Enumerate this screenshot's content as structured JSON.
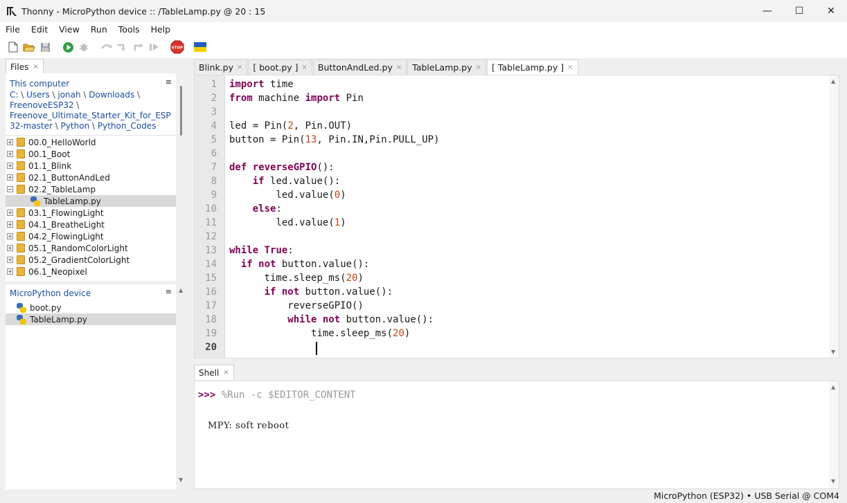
{
  "window": {
    "app_name": "Thonny",
    "title": "Thonny  -  MicroPython device :: /TableLamp.py  @  20 : 15",
    "minimize": "—",
    "maximize": "☐",
    "close": "✕"
  },
  "menu": [
    "File",
    "Edit",
    "View",
    "Run",
    "Tools",
    "Help"
  ],
  "toolbar": {
    "stop_label": "STOP"
  },
  "files_tab": {
    "label": "Files",
    "close": "×"
  },
  "this_computer": {
    "header": "This computer",
    "menu": "≡",
    "path": [
      "C:",
      "Users",
      "jonah",
      "Downloads",
      "FreenoveESP32",
      "Freenove_Ultimate_Starter_Kit_for_ESP32-master",
      "Python",
      "Python_Codes"
    ],
    "items": [
      {
        "name": "00.0_HelloWorld",
        "type": "folder",
        "expander": "+"
      },
      {
        "name": "00.1_Boot",
        "type": "folder",
        "expander": "+"
      },
      {
        "name": "01.1_Blink",
        "type": "folder",
        "expander": "+"
      },
      {
        "name": "02.1_ButtonAndLed",
        "type": "folder",
        "expander": "+"
      },
      {
        "name": "02.2_TableLamp",
        "type": "folder",
        "expander": "−"
      },
      {
        "name": "TableLamp.py",
        "type": "py",
        "expander": "",
        "selected": true,
        "indent": 1
      },
      {
        "name": "03.1_FlowingLight",
        "type": "folder",
        "expander": "+"
      },
      {
        "name": "04.1_BreatheLight",
        "type": "folder",
        "expander": "+"
      },
      {
        "name": "04.2_FlowingLight",
        "type": "folder",
        "expander": "+"
      },
      {
        "name": "05.1_RandomColorLight",
        "type": "folder",
        "expander": "+"
      },
      {
        "name": "05.2_GradientColorLight",
        "type": "folder",
        "expander": "+"
      },
      {
        "name": "06.1_Neopixel",
        "type": "folder",
        "expander": "+"
      }
    ]
  },
  "device": {
    "header": "MicroPython device",
    "menu": "≡",
    "items": [
      {
        "name": "boot.py",
        "selected": false
      },
      {
        "name": "TableLamp.py",
        "selected": true
      }
    ]
  },
  "editor_tabs": [
    {
      "label": "Blink.py",
      "active": false
    },
    {
      "label": "[ boot.py ]",
      "active": false
    },
    {
      "label": "ButtonAndLed.py",
      "active": false
    },
    {
      "label": "TableLamp.py",
      "active": false
    },
    {
      "label": "[ TableLamp.py ]",
      "active": true
    }
  ],
  "tab_close": "×",
  "editor": {
    "current_line": 20,
    "lines": [
      "import time",
      "from machine import Pin",
      "",
      "led = Pin(2, Pin.OUT)",
      "button = Pin(13, Pin.IN,Pin.PULL_UP)",
      "",
      "def reverseGPIO():",
      "    if led.value():",
      "        led.value(0)",
      "    else:",
      "        led.value(1)",
      "",
      "while True:",
      "  if not button.value():",
      "      time.sleep_ms(20)",
      "      if not button.value():",
      "          reverseGPIO()",
      "          while not button.value():",
      "              time.sleep_ms(20)",
      ""
    ]
  },
  "shell": {
    "tab_label": "Shell",
    "prompt": ">>>",
    "command": "%Run -c $EDITOR_CONTENT",
    "output": "MPY: soft reboot"
  },
  "status": "MicroPython (ESP32)  •  USB Serial @ COM4",
  "colors": {
    "keyword": "#7f0055",
    "number": "#c0461c",
    "link": "#1a4fa0",
    "selection": "#d9d9d9"
  }
}
